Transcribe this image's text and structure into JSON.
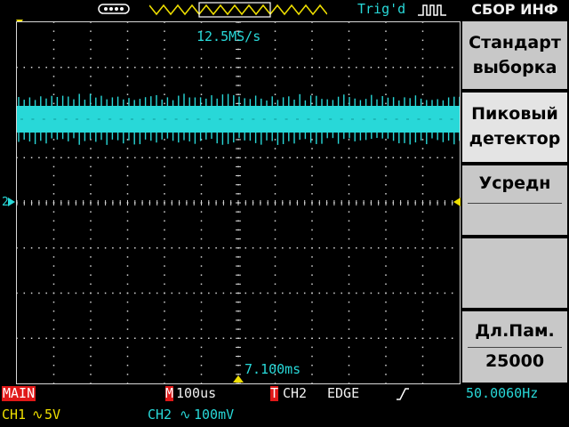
{
  "top": {
    "usb_icon": "usb-icon",
    "trig_status": "Trig'd"
  },
  "screen": {
    "sample_rate": "12.5MS/s",
    "trigger_time": "7.100ms",
    "ch2_marker": "2"
  },
  "menu": {
    "title": "СБОР ИНФ",
    "buttons": [
      {
        "line1": "Стандарт",
        "line2": "выборка"
      },
      {
        "line1": "Пиковый",
        "line2": "детектор"
      },
      {
        "line1": "Усредн",
        "line2": ""
      },
      {
        "line1": "",
        "line2": ""
      },
      {
        "line1": "Дл.Пам.",
        "line2": "25000"
      }
    ]
  },
  "status": {
    "mode": "MAIN",
    "timebase_prefix": "M",
    "timebase": "100us",
    "trig_prefix": "T",
    "trig_source": "CH2",
    "trig_type": "EDGE",
    "frequency": "50.0060Hz",
    "ch1_label": "CH1",
    "ch1_scale": "5V",
    "ch2_label": "CH2",
    "ch2_scale": "100mV"
  },
  "colors": {
    "ch1": "#f0e000",
    "ch2": "#28d8d8",
    "grid": "#d8d8d8",
    "menu_button": "#c8c8c8",
    "warning": "#e01818"
  }
}
